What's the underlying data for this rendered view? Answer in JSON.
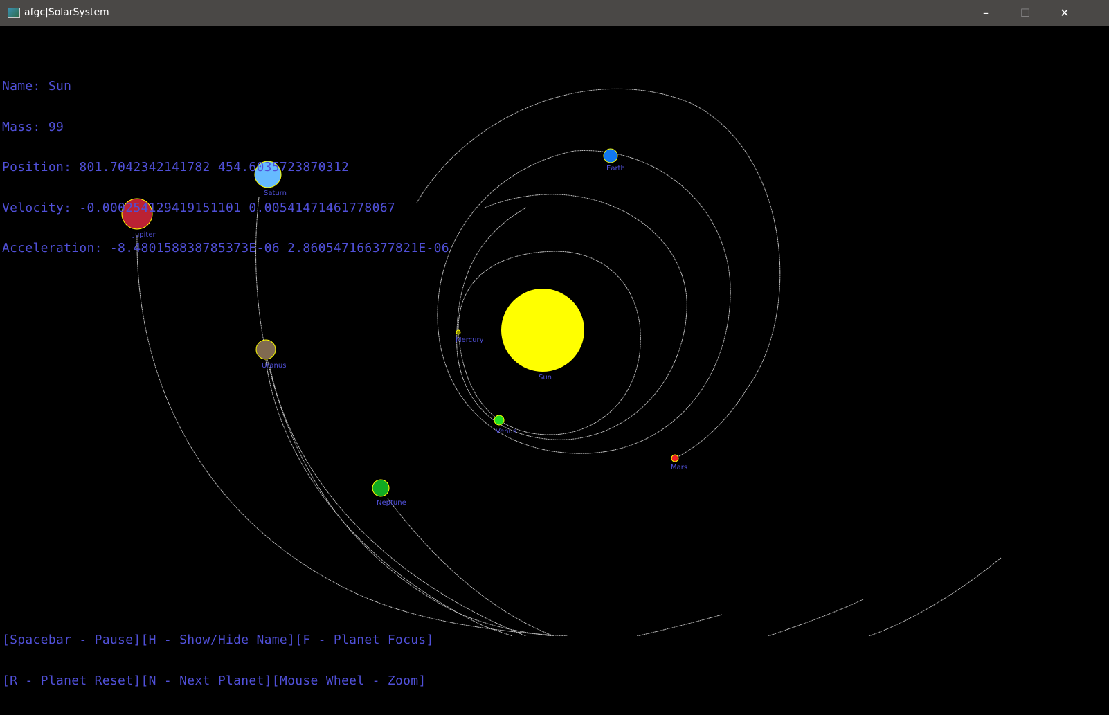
{
  "window": {
    "title": "afgc|SolarSystem",
    "minimize": "–",
    "maximize": "☐",
    "close": "✕"
  },
  "info": {
    "name": "Name: Sun",
    "mass": "Mass: 99",
    "position": "Position: 801.7042342141782 454.6035723870312",
    "velocity": "Velocity: -0.000254129419151101 0.0054147146177806​7",
    "acceleration": "Acceleration: -8.480158838785373E-06 2.860547166377821E-06"
  },
  "help": {
    "line1": "[Spacebar - Pause][H - Show/Hide Name][F - Planet Focus]",
    "line2": "[R - Planet Reset][N - Next Planet][Mouse Wheel - Zoom]"
  },
  "bodies": [
    {
      "name": "Sun",
      "color": "#ffff00"
    },
    {
      "name": "Mercury",
      "color": "#888800"
    },
    {
      "name": "Venus",
      "color": "#22dd22"
    },
    {
      "name": "Earth",
      "color": "#1177ee"
    },
    {
      "name": "Mars",
      "color": "#ee2222"
    },
    {
      "name": "Jupiter",
      "color": "#bb2233"
    },
    {
      "name": "Saturn",
      "color": "#66bbff"
    },
    {
      "name": "Uranus",
      "color": "#806a50"
    },
    {
      "name": "Neptune",
      "color": "#11aa22"
    }
  ]
}
